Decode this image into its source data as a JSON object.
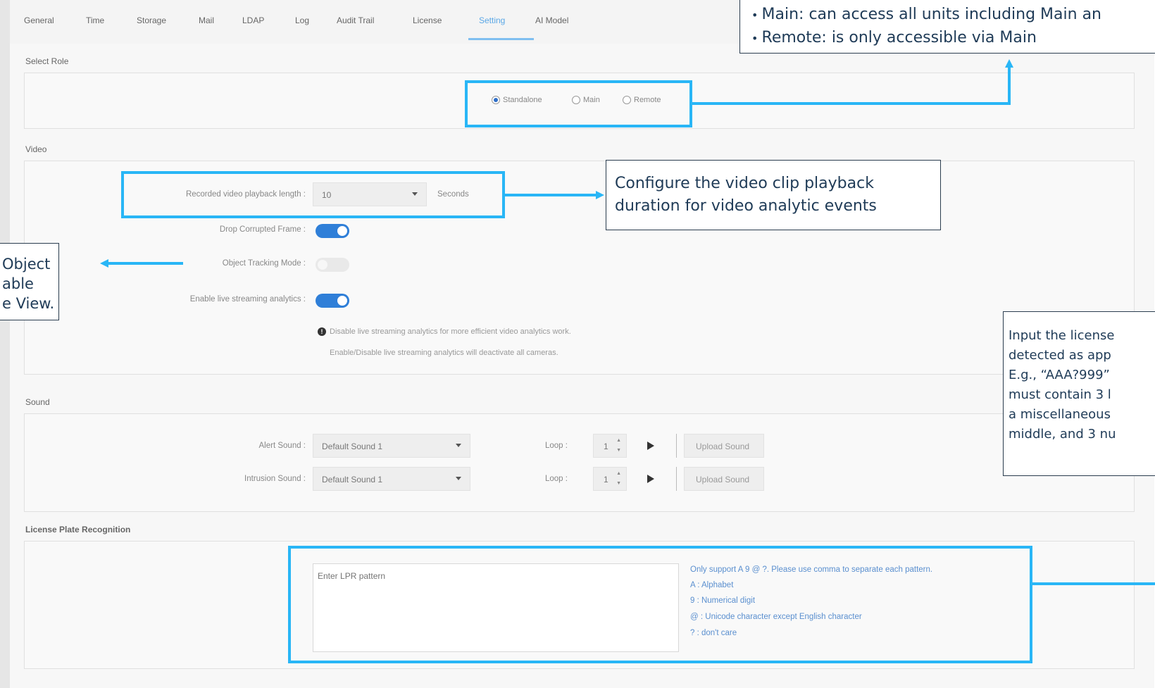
{
  "tabs": [
    "General",
    "Time",
    "Storage",
    "Mail",
    "LDAP",
    "Log",
    "Audit Trail",
    "License",
    "Setting",
    "AI Model"
  ],
  "active_tab": "Setting",
  "select_role": {
    "title": "Select Role",
    "options": [
      "Standalone",
      "Main",
      "Remote"
    ],
    "selected": "Standalone"
  },
  "video": {
    "title": "Video",
    "playback_label": "Recorded video playback length :",
    "playback_value": "10",
    "playback_unit": "Seconds",
    "drop_corrupted_label": "Drop Corrupted Frame :",
    "drop_corrupted_on": true,
    "object_tracking_label": "Object Tracking Mode :",
    "object_tracking_on": false,
    "live_analytics_label": "Enable live streaming analytics :",
    "live_analytics_on": true,
    "note_1": "Disable live streaming analytics for more efficient video analytics work.",
    "note_2": "Enable/Disable live streaming analytics will deactivate all cameras."
  },
  "sound": {
    "title": "Sound",
    "alert_label": "Alert Sound :",
    "alert_value": "Default Sound 1",
    "intrusion_label": "Intrusion Sound :",
    "intrusion_value": "Default Sound 1",
    "loop_label": "Loop :",
    "loop_value": "1",
    "upload_label": "Upload Sound"
  },
  "lpr": {
    "title": "License Plate Recognition",
    "placeholder": "Enter LPR pattern",
    "help": [
      "Only support A 9 @ ?. Please use comma to separate each pattern.",
      "A : Alphabet",
      "9 : Numerical digit",
      "@ : Unicode character except English character",
      "? : don't care"
    ]
  },
  "callouts": {
    "role_lines": [
      "Main: can access all units including Main an",
      "Remote: is only accessible via Main"
    ],
    "video": [
      "Configure the video clip playback",
      "duration for video analytic events"
    ],
    "object": [
      "Object",
      "able",
      "e View."
    ],
    "lpr": [
      "Input the license",
      "detected as app",
      "E.g., “AAA?999”",
      "must contain 3 l",
      "a miscellaneous",
      "middle, and 3 nu"
    ]
  },
  "colors": {
    "highlight": "#29b6f6",
    "toggle_on": "#2f7fd8",
    "active_tab": "#5aa7e6",
    "callout_text": "#1f3b57"
  }
}
